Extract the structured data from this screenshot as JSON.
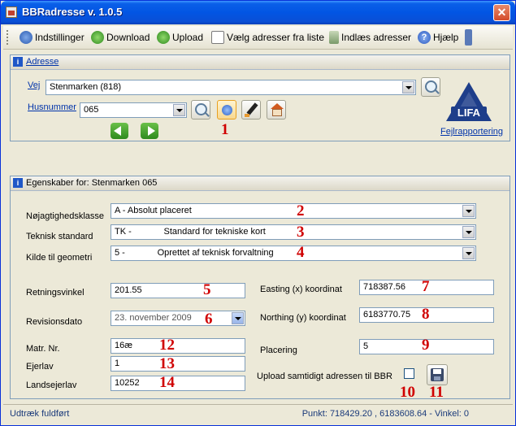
{
  "window": {
    "title": "BBRadresse v. 1.0.5",
    "close_label": "✕"
  },
  "toolbar": {
    "settings_label": "Indstillinger",
    "download_label": "Download",
    "upload_label": "Upload",
    "choose_list_label": "Vælg adresser fra liste",
    "import_label": "Indlæs adresser",
    "help_label": "Hjælp"
  },
  "address_panel": {
    "header": "Adresse",
    "vej_label": "Vej",
    "vej_value": "Stenmarken (818)",
    "husnummer_label": "Husnummer",
    "husnummer_value": "065",
    "logo_text": "LIFA",
    "feilrapport_link": "Fejlrapportering"
  },
  "properties_panel": {
    "header": "Egenskaber for: Stenmarken 065",
    "noejagtighed_label": "Nøjagtighedsklasse",
    "noejagtighed_value": "A - Absolut placeret",
    "teknisk_label": "Teknisk standard",
    "teknisk_value": "TK -             Standard for tekniske kort",
    "kilde_label": "Kilde til geometri",
    "kilde_value": "5 -             Oprettet af teknisk forvaltning",
    "retning_label": "Retningsvinkel",
    "retning_value": "201.55",
    "revision_label": "Revisionsdato",
    "revision_value": "23. november 2009",
    "matr_label": "Matr. Nr.",
    "matr_value": "16æ",
    "ejerlav_label": "Ejerlav",
    "ejerlav_value": "1",
    "landsejerlav_label": "Landsejerlav",
    "landsejerlav_value": "10252",
    "easting_label": "Easting (x) koordinat",
    "easting_value": "718387.56",
    "northing_label": "Northing (y) koordinat",
    "northing_value": "6183770.75",
    "placering_label": "Placering",
    "placering_value": "5",
    "upload_bbr_label": "Upload samtidigt adressen til BBR"
  },
  "annotations": [
    "1",
    "2",
    "3",
    "4",
    "5",
    "6",
    "7",
    "8",
    "9",
    "10",
    "11",
    "12",
    "13",
    "14"
  ],
  "status": {
    "left": "Udtræk fuldført",
    "right": "Punkt: 718429.20 , 6183608.64 - Vinkel: 0"
  }
}
